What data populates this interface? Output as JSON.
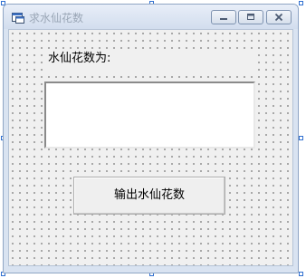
{
  "window": {
    "title": "求水仙花数"
  },
  "title_buttons": {
    "minimize": "minimize-icon",
    "maximize": "maximize-icon",
    "close": "close-icon"
  },
  "form": {
    "label_text": "水仙花数为:",
    "textbox_value": "",
    "button_label": "输出水仙花数"
  },
  "colors": {
    "handle": "#2f6fd0",
    "client_bg": "#f0f0f0",
    "grid_dot": "#4a4a4a"
  }
}
